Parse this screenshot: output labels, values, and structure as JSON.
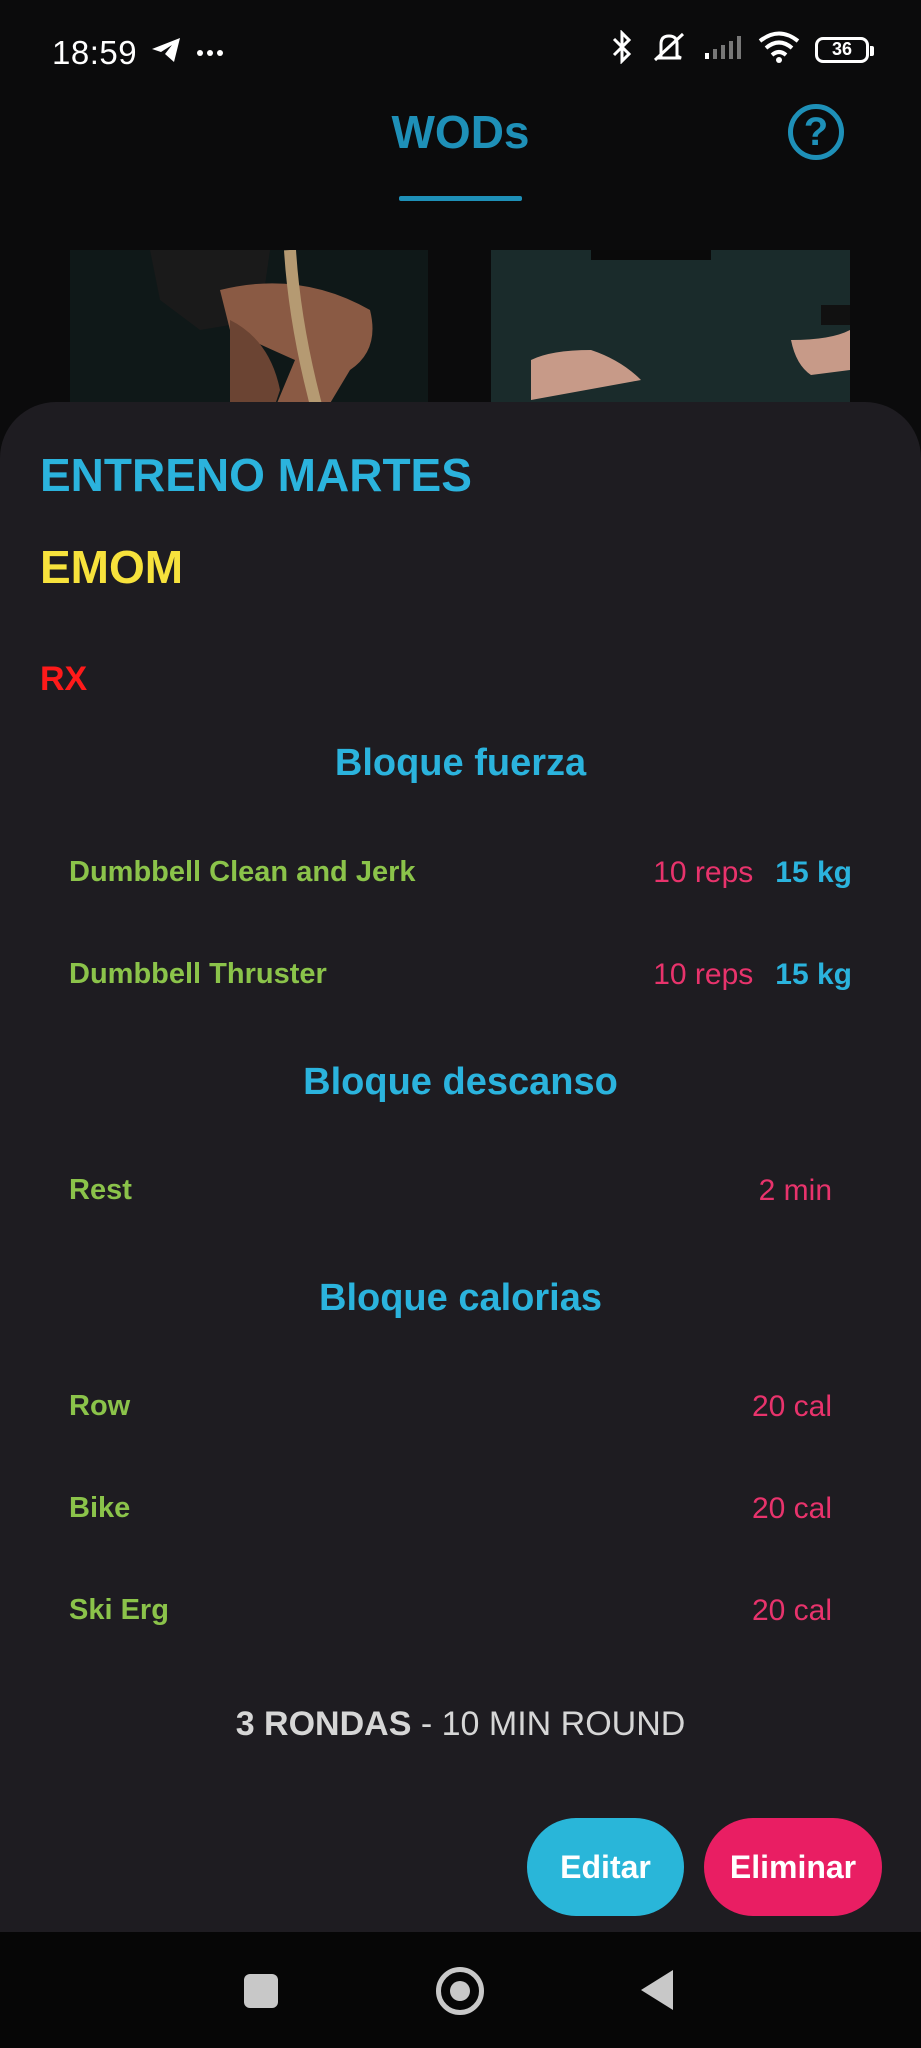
{
  "status_bar": {
    "time": "18:59",
    "left_icons": [
      "telegram-icon",
      "more-icon"
    ],
    "right_icons": [
      "bluetooth-icon",
      "mute-icon",
      "signal-icon",
      "wifi-icon"
    ],
    "battery": "36"
  },
  "header": {
    "title": "WODs",
    "help_icon": "?"
  },
  "wod": {
    "title": "ENTRENO MARTES",
    "type": "EMOM",
    "level": "RX",
    "blocks": [
      {
        "title": "Bloque fuerza",
        "exercises": [
          {
            "name": "Dumbbell Clean and Jerk",
            "reps": "10 reps",
            "weight": "15 kg"
          },
          {
            "name": "Dumbbell Thruster",
            "reps": "10 reps",
            "weight": "15 kg"
          }
        ]
      },
      {
        "title": "Bloque descanso",
        "exercises": [
          {
            "name": "Rest",
            "value": "2 min"
          }
        ]
      },
      {
        "title": "Bloque calorias",
        "exercises": [
          {
            "name": "Row",
            "value": "20 cal"
          },
          {
            "name": "Bike",
            "value": "20 cal"
          },
          {
            "name": "Ski Erg",
            "value": "20 cal"
          }
        ]
      }
    ],
    "summary_rounds": "3 RONDAS",
    "summary_separator": " - ",
    "summary_round_time": "10 MIN ROUND"
  },
  "actions": {
    "edit": "Editar",
    "delete": "Eliminar"
  },
  "colors": {
    "accent_blue": "#2bb3dd",
    "header_blue": "#1e90b8",
    "yellow": "#f7e23c",
    "red": "#ff1a1a",
    "pink": "#e8336c",
    "green": "#8bc34a"
  }
}
